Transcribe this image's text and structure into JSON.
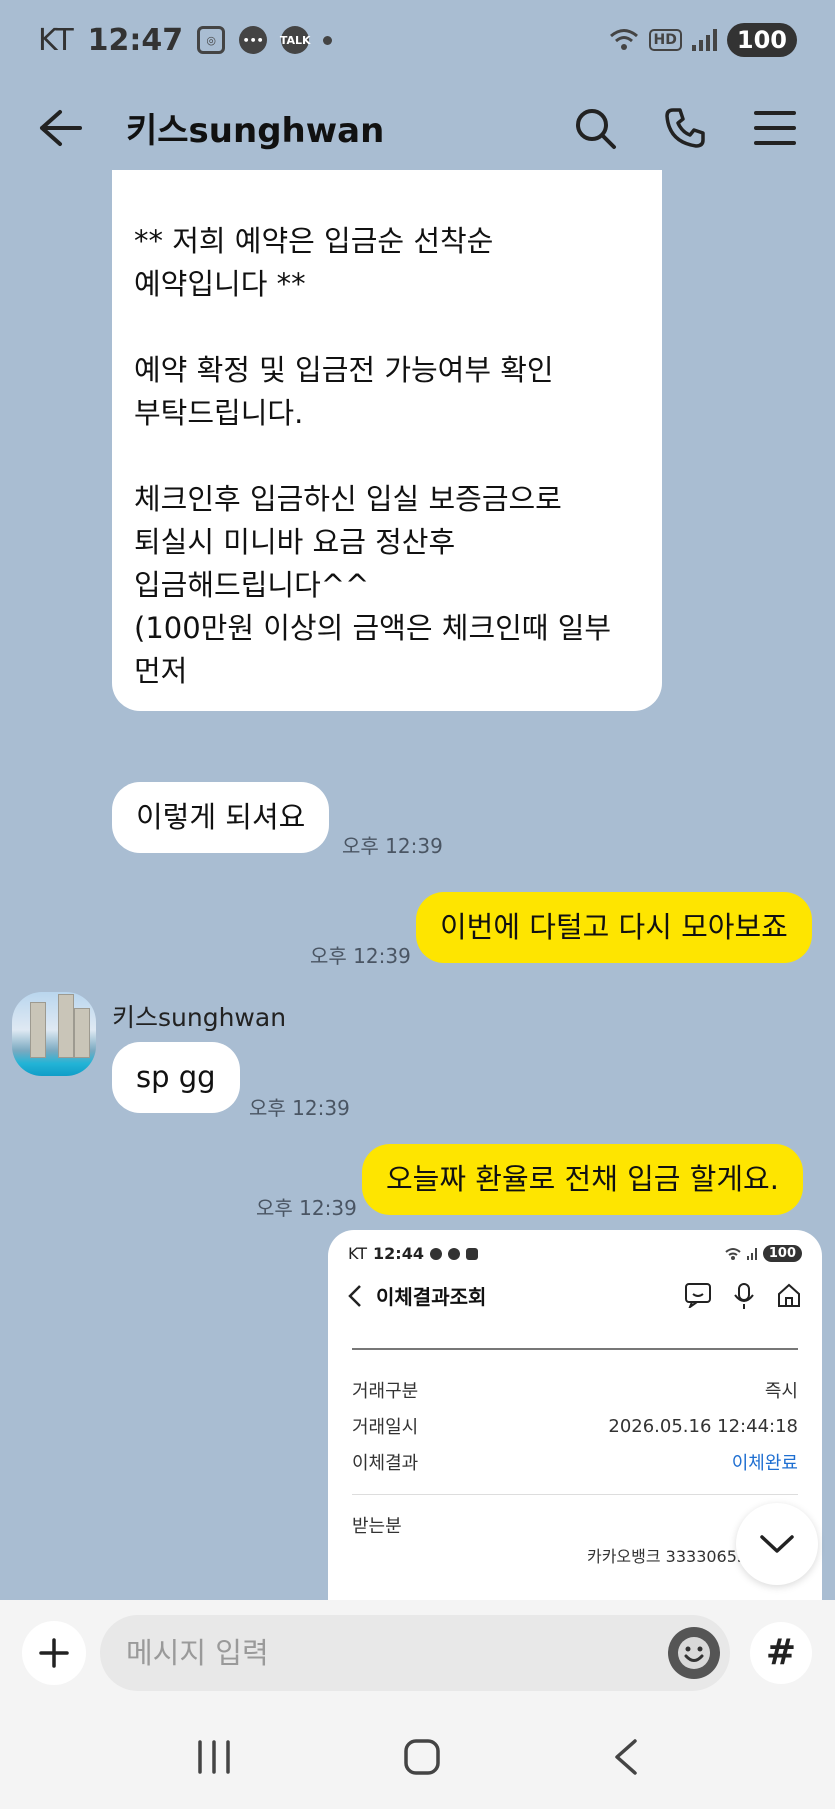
{
  "status_bar": {
    "carrier": "KT",
    "time": "12:47",
    "talk_label": "TALK",
    "hd_label": "HD",
    "battery": "100"
  },
  "header": {
    "title": "키스sunghwan"
  },
  "messages": {
    "big_text": "** 저희 예약은 입금순 선착순\n예약입니다 **\n\n예약 확정 및 입금전 가능여부 확인\n부탁드립니다.\n\n체크인후 입금하신 입실 보증금으로\n퇴실시 미니바 요금 정산후\n입금해드립니다^^\n(100만원 이상의 금액은 체크인때 일부\n먼저",
    "m1_text": "이렇게 되셔요",
    "m1_time": "오후 12:39",
    "m2_text": "이번에 다털고 다시 모아보죠",
    "m2_time": "오후 12:39",
    "sender_name": "키스sunghwan",
    "m3_text": "sp gg",
    "m3_time": "오후 12:39",
    "m4_text": "오늘짜 환율로  전채 입금 할게요.",
    "m4_time": "오후 12:39"
  },
  "receipt": {
    "carrier": "KT",
    "time": "12:44",
    "battery": "100",
    "title": "이체결과조회",
    "rows": [
      {
        "label": "거래구분",
        "value": "즉시"
      },
      {
        "label": "거래일시",
        "value": "2026.05.16 12:44:18"
      },
      {
        "label": "이체결과",
        "value": "이체완료"
      }
    ],
    "recipient_label": "받는분",
    "account": "카카오뱅크 3333065505950"
  },
  "input": {
    "placeholder": "메시지 입력",
    "hash": "#"
  }
}
